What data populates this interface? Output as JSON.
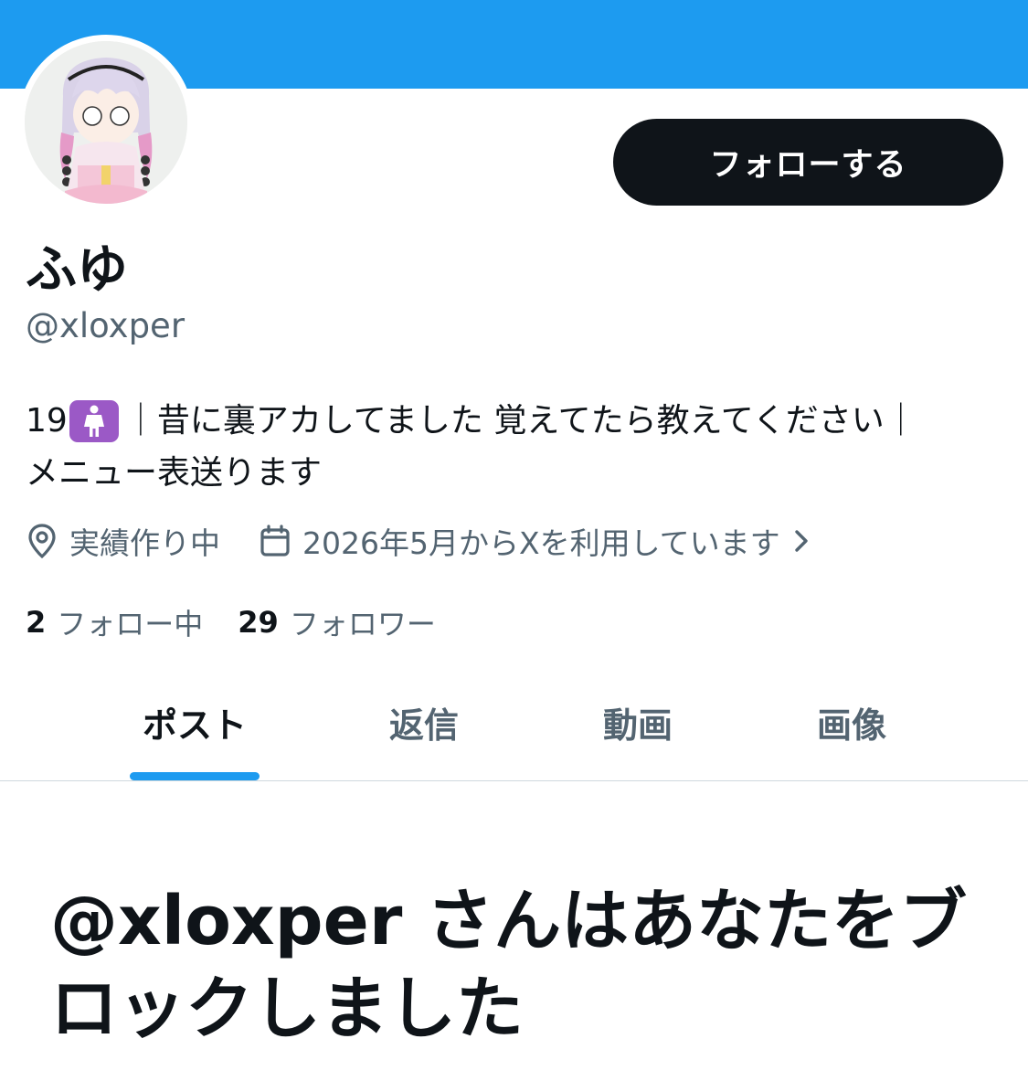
{
  "profile": {
    "display_name": "ふゆ",
    "handle": "@xloxper",
    "follow_button_label": "フォローする",
    "bio_prefix": "19",
    "bio_emoji": "standing-woman-emoji",
    "bio_line1_rest": "｜昔に裏アカしてました 覚えてたら教えてください｜",
    "bio_line2": "メニュー表送ります",
    "location": "実績作り中",
    "joined": "2026年5月からXを利用しています"
  },
  "stats": {
    "following_count": "2",
    "following_label": "フォロー中",
    "followers_count": "29",
    "followers_label": "フォロワー"
  },
  "tabs": [
    {
      "label": "ポスト",
      "active": true
    },
    {
      "label": "返信",
      "active": false
    },
    {
      "label": "動画",
      "active": false
    },
    {
      "label": "画像",
      "active": false
    }
  ],
  "blocked_message": "@xloxper さんはあなたをブロックしました",
  "colors": {
    "banner": "#1d9bf0",
    "primary_text": "#0f1419",
    "secondary_text": "#536471",
    "accent": "#1d9bf0",
    "emoji_bg": "#9b59c6"
  },
  "icons": [
    "location-pin-icon",
    "calendar-icon",
    "chevron-right-icon"
  ]
}
